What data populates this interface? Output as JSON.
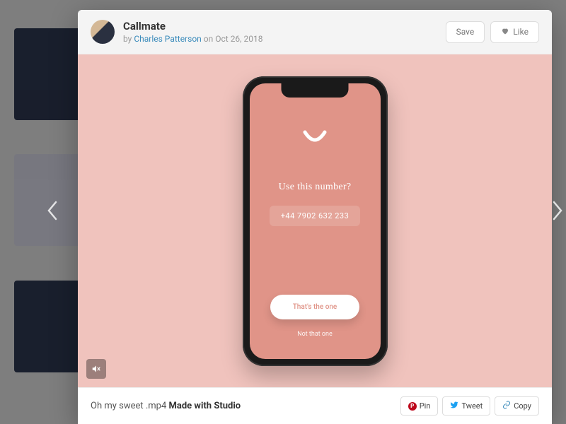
{
  "header": {
    "title": "Callmate",
    "by_prefix": "by",
    "author": "Charles Patterson",
    "on_prefix": "on",
    "date": "Oct 26, 2018",
    "save_label": "Save",
    "like_label": "Like"
  },
  "mockup": {
    "question": "Use this number?",
    "phone_number": "+44 7902 632 233",
    "cta_primary": "That's the one",
    "cta_secondary": "Not that one"
  },
  "footer": {
    "caption_prefix": "Oh my sweet .mp4 ",
    "caption_bold": "Made with Studio",
    "pin": "Pin",
    "tweet": "Tweet",
    "copy": "Copy"
  }
}
